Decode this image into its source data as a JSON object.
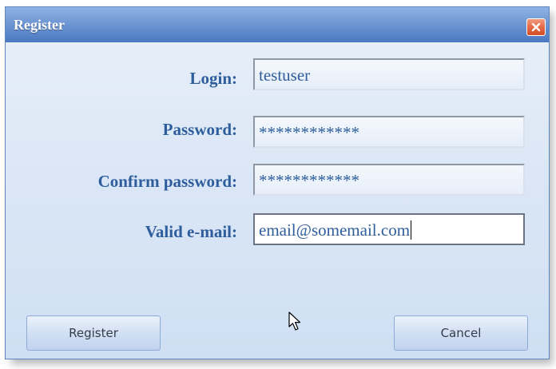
{
  "window": {
    "title": "Register"
  },
  "form": {
    "fields": [
      {
        "label": "Login:",
        "value": "testuser"
      },
      {
        "label": "Password:",
        "value": "************"
      },
      {
        "label": "Confirm password:",
        "value": "************"
      },
      {
        "label": "Valid e-mail:",
        "value": "email@somemail.com"
      }
    ]
  },
  "buttons": {
    "register_label": "Register",
    "cancel_label": "Cancel"
  },
  "icons": {
    "close": "close-icon",
    "cursor": "mouse-pointer-icon"
  },
  "colors": {
    "label_text": "#2d5d9c",
    "titlebar": "#4a78c2",
    "close_button": "#d34c28"
  }
}
